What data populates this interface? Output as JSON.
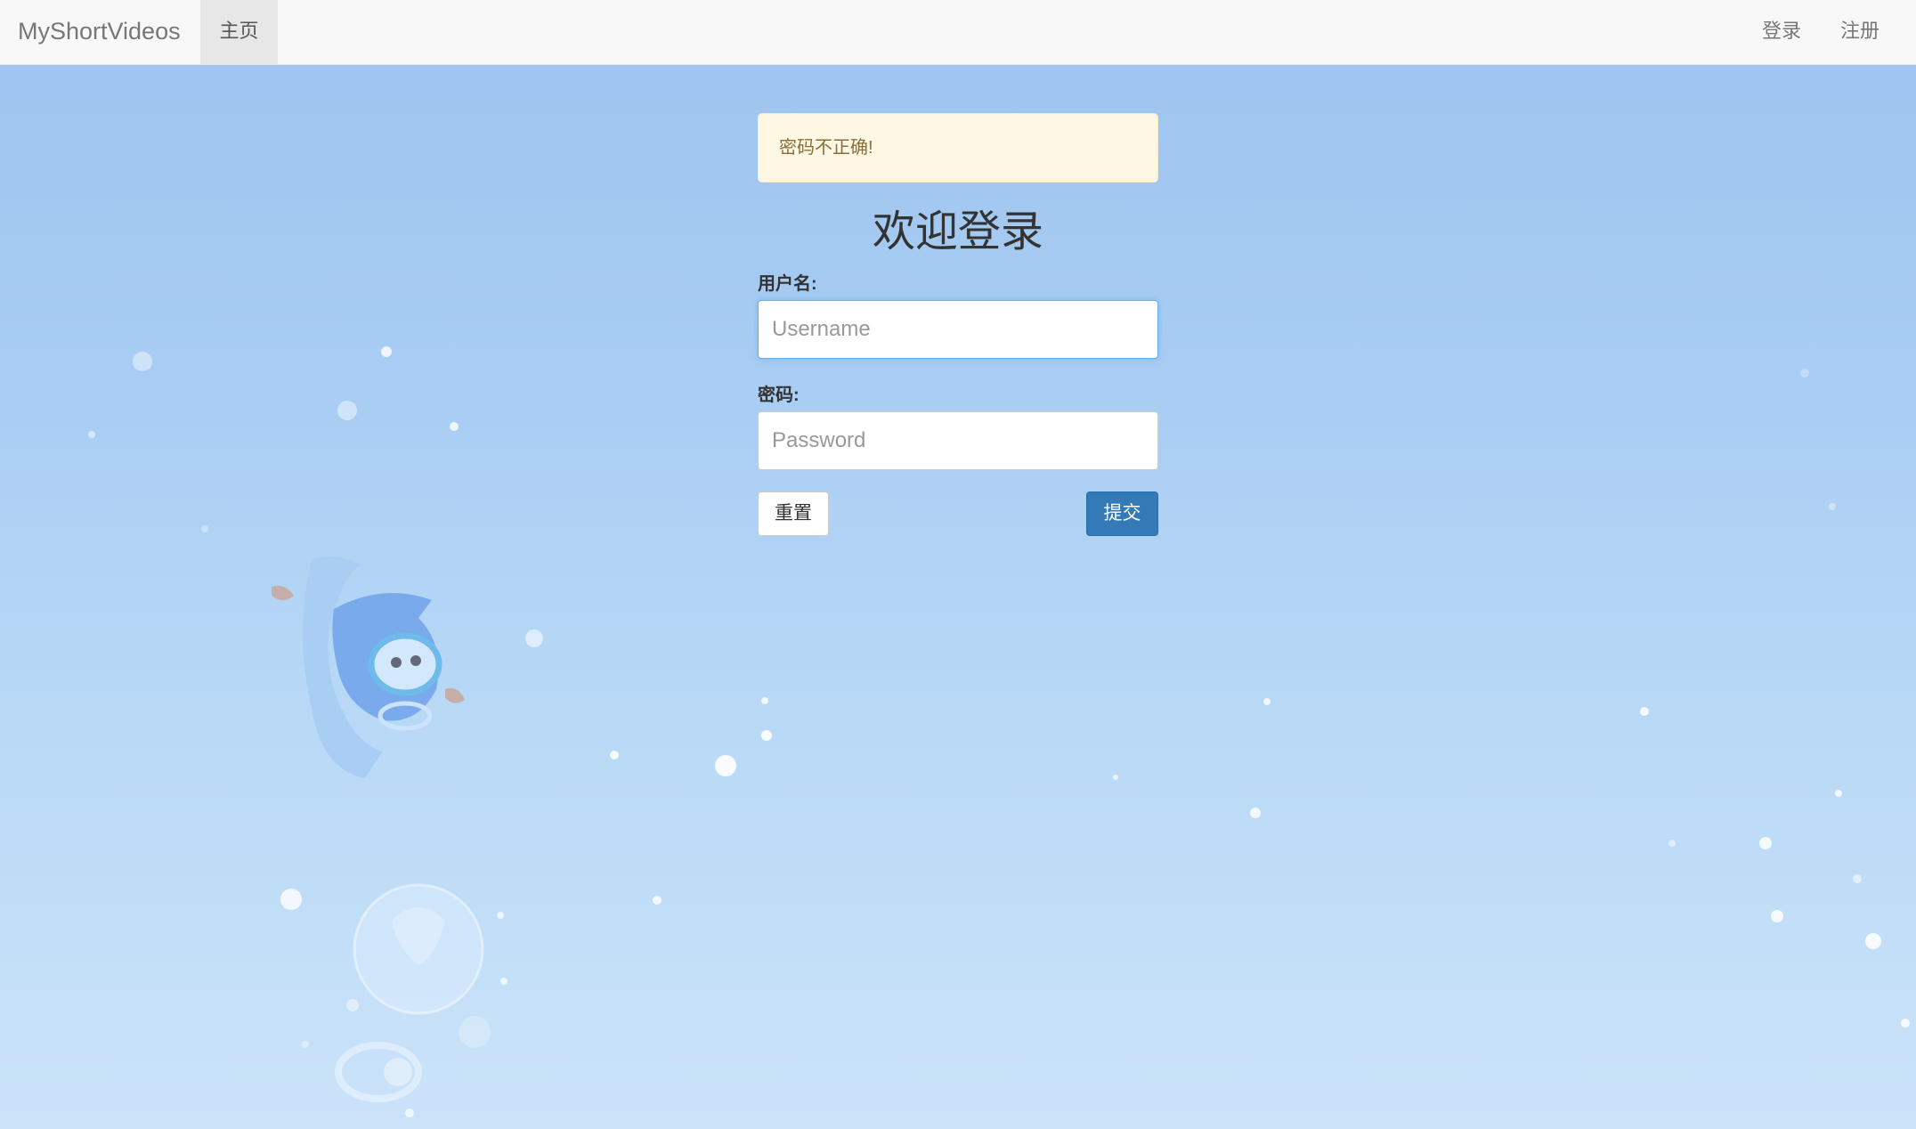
{
  "navbar": {
    "brand": "MyShortVideos",
    "home_label": "主页",
    "login_label": "登录",
    "register_label": "注册"
  },
  "alert": {
    "message": "密码不正确!"
  },
  "form": {
    "title": "欢迎登录",
    "username_label": "用户名:",
    "username_placeholder": "Username",
    "password_label": "密码:",
    "password_placeholder": "Password",
    "reset_label": "重置",
    "submit_label": "提交"
  },
  "colors": {
    "navbar_bg": "#f8f8f8",
    "alert_bg": "#fcf8e3",
    "alert_text": "#8a6d3b",
    "primary_button": "#337ab7",
    "background_top": "#9cc4ef",
    "background_bottom": "#cbe3f9"
  },
  "decorations": {
    "background_illustration": "underwater-dolphin-bubbles"
  }
}
